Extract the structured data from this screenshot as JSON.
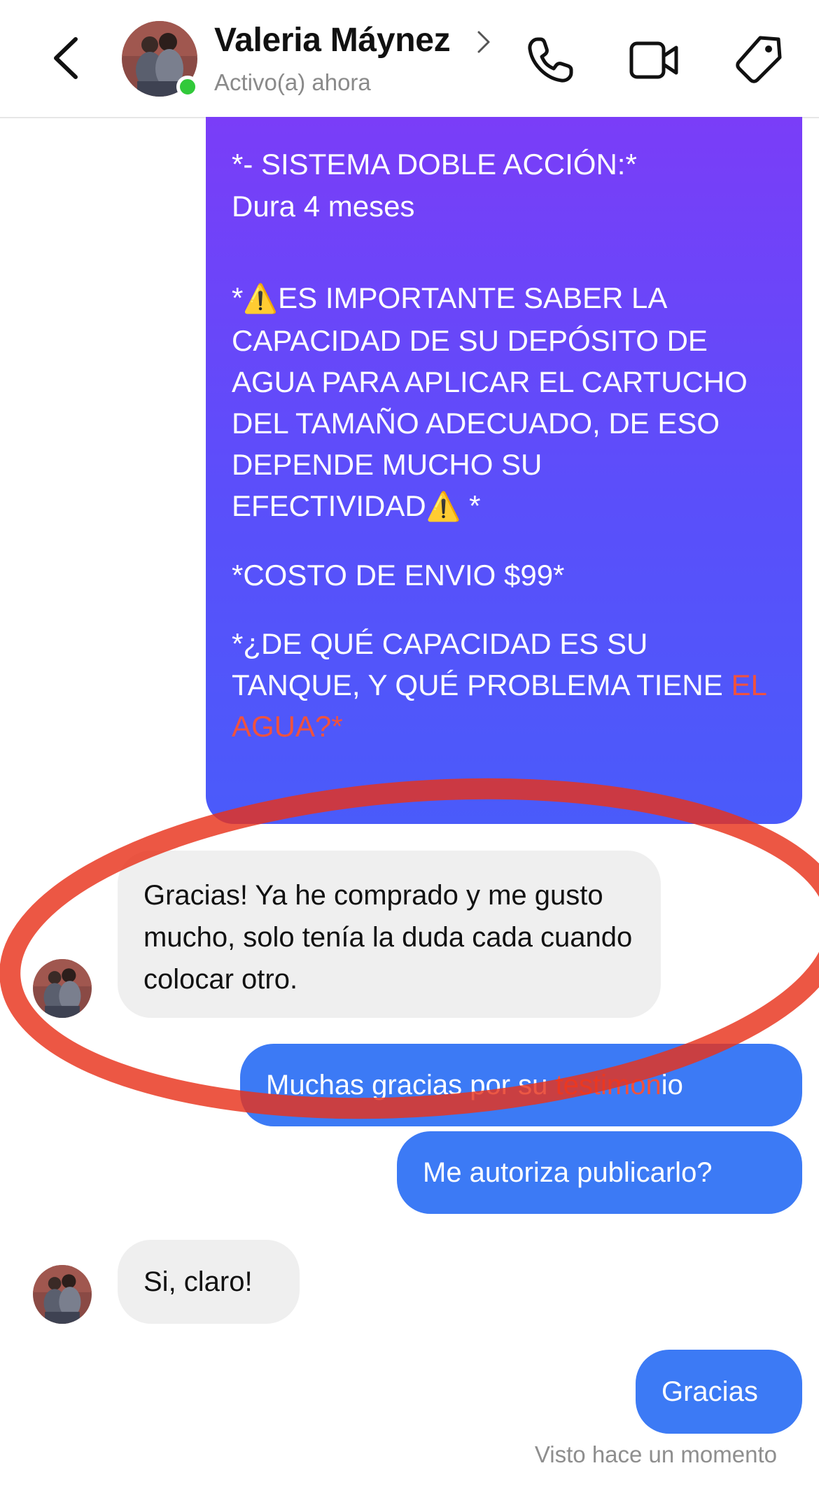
{
  "header": {
    "name": "Valeria Máynez",
    "status": "Activo(a) ahora",
    "icons": [
      "back-chevron-icon",
      "phone-icon",
      "video-camera-icon",
      "tag-icon"
    ]
  },
  "messages": {
    "promo": {
      "line1": "*- SISTEMA DOBLE ACCIÓN:*",
      "line2": "Dura 4 meses",
      "warn_pre": "*",
      "warn_text": "ES IMPORTANTE SABER LA CAPACIDAD DE SU DEPÓSITO DE AGUA PARA APLICAR EL CARTUCHO DEL TAMAÑO ADECUADO, DE ESO DEPENDE MUCHO SU EFECTIVIDAD",
      "warn_post": " *",
      "shipping": "*COSTO DE ENVIO $99*",
      "question_main": "*¿DE QUÉ CAPACIDAD ES SU TANQUE, Y QUÉ PROBLEMA TIENE ",
      "question_tail": "EL AGUA?*"
    },
    "incoming_1": "Gracias! Ya he comprado y me gusto mucho, solo tenía la duda cada cuando colocar otro.",
    "outgoing_1_a": "Muchas gracias por su ",
    "outgoing_1_b": "testimon",
    "outgoing_1_c": "io",
    "outgoing_2": "Me autoriza publicarlo?",
    "incoming_2": "Si, claro!",
    "outgoing_3": "Gracias"
  },
  "footer": {
    "seen": "Visto hace un momento"
  },
  "colors": {
    "outgoing_bubble": "#3c7af5",
    "promo_gradient_top": "#7a3df8",
    "promo_gradient_bottom": "#4a5bfa",
    "incoming_bubble": "#efefef",
    "online": "#31c93a",
    "annotation_circle": "#e8321b"
  }
}
